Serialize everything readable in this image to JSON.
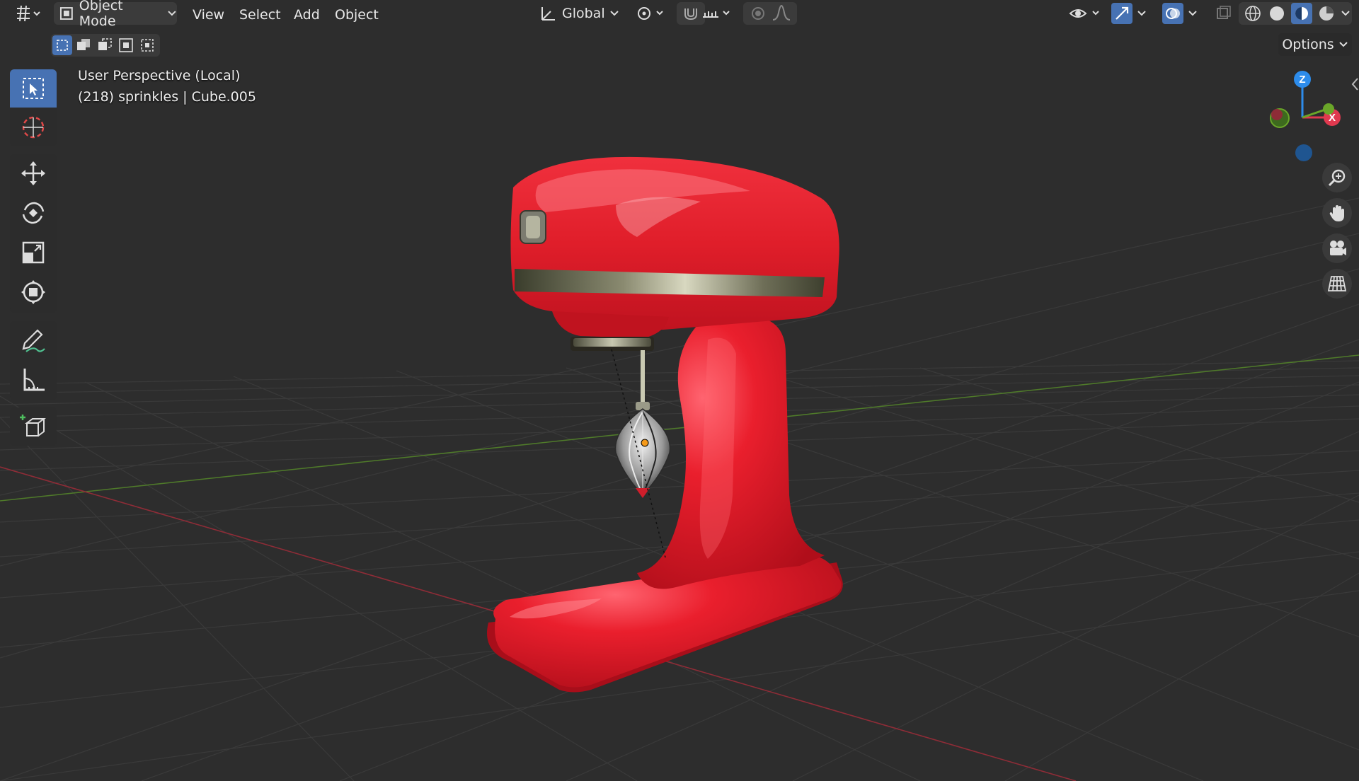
{
  "header": {
    "mode_label": "Object Mode",
    "menus": [
      "View",
      "Select",
      "Add",
      "Object"
    ],
    "transform_orientation": "Global",
    "options_label": "Options"
  },
  "viewport": {
    "view_name": "User Perspective (Local)",
    "object_info": "(218) sprinkles | Cube.005"
  },
  "gizmo": {
    "z_label": "Z",
    "x_label": "X"
  },
  "colors": {
    "accent": "#4772b3",
    "background": "#2d2d2d",
    "mixer_red": "#e8202e",
    "axis_x": "#e0394f",
    "axis_y": "#6aa629",
    "axis_z": "#2d8ceb"
  },
  "icons": {
    "toolbar": [
      "select-box-icon",
      "cursor-icon",
      "move-icon",
      "rotate-icon",
      "scale-icon",
      "transform-icon",
      "annotate-icon",
      "measure-icon",
      "add-cube-icon"
    ],
    "navigation": [
      "zoom-icon",
      "hand-pan-icon",
      "camera-icon",
      "grid-ortho-icon"
    ]
  }
}
